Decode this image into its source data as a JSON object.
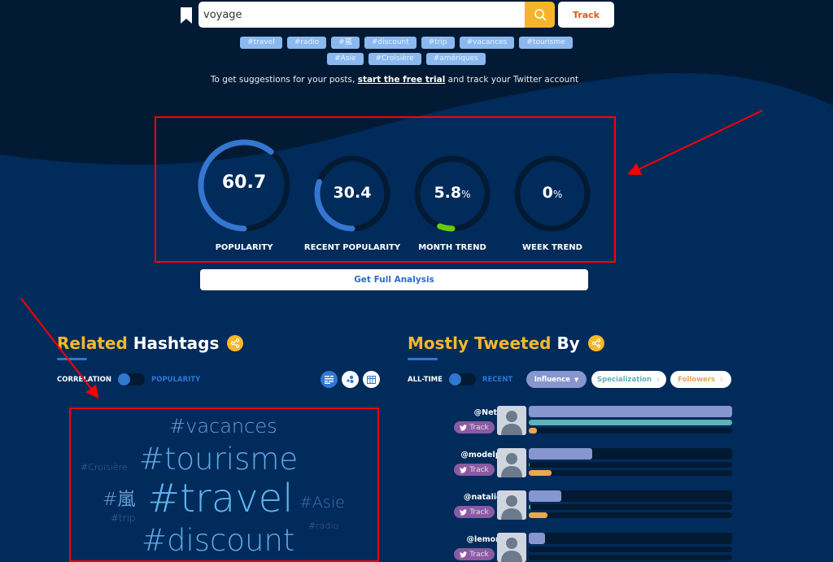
{
  "search": {
    "value": "voyage",
    "track_label": "Track"
  },
  "tags_row1": [
    "#travel",
    "#radio",
    "#嵐",
    "#discount",
    "#trip",
    "#vacances",
    "#tourisme"
  ],
  "tags_row2": [
    "#Asie",
    "#Croisière",
    "#amériques"
  ],
  "suggest": {
    "before": "To get suggestions for your posts, ",
    "link": "start the free trial",
    "after": " and track your Twitter account"
  },
  "metrics": [
    {
      "label": "POPULARITY",
      "value": "60.7",
      "unit": "",
      "fraction": 0.607,
      "color": "#3477d1"
    },
    {
      "label": "RECENT POPULARITY",
      "value": "30.4",
      "unit": "",
      "fraction": 0.304,
      "color": "#3477d1"
    },
    {
      "label": "MONTH TREND",
      "value": "5.8",
      "unit": "%",
      "fraction": 0.058,
      "color": "#66cc11"
    },
    {
      "label": "WEEK TREND",
      "value": "0",
      "unit": "%",
      "fraction": 0,
      "color": "#3477d1"
    }
  ],
  "full_analysis_label": "Get Full Analysis",
  "related": {
    "title_accent": "Related",
    "title_rest": "Hashtags",
    "toggle_left": "CORRELATION",
    "toggle_right": "POPULARITY",
    "cloud": [
      {
        "text": "#vacances",
        "weight": 0.55
      },
      {
        "text": "#tourisme",
        "weight": 0.8
      },
      {
        "text": "#Croisière",
        "weight": 0.2
      },
      {
        "text": "#嵐",
        "weight": 0.45
      },
      {
        "text": "#travel",
        "weight": 1.0
      },
      {
        "text": "#Asie",
        "weight": 0.4
      },
      {
        "text": "#trip",
        "weight": 0.3
      },
      {
        "text": "#radio",
        "weight": 0.25
      },
      {
        "text": "#discount",
        "weight": 0.78
      }
    ]
  },
  "tweeted_by": {
    "title_accent": "Mostly Tweeted",
    "title_rest": "By",
    "toggle_left": "ALL-TIME",
    "toggle_right": "RECENT",
    "sort_influence": "Influence",
    "sort_specialization": "Specialization",
    "sort_followers": "Followers",
    "track_label": "Track",
    "users": [
      {
        "handle": "@NetflixJP",
        "influence": 1.0,
        "specialization": 1.0,
        "followers": 0.04
      },
      {
        "handle": "@modelpress",
        "influence": 0.31,
        "specialization": 0.003,
        "followers": 0.11
      },
      {
        "handle": "@natalie_mu",
        "influence": 0.16,
        "specialization": 0.008,
        "followers": 0.09
      },
      {
        "handle": "@lemondefr",
        "influence": 0.08,
        "specialization": 0.0,
        "followers": 0.0
      }
    ]
  },
  "colors": {
    "accent_yellow": "#f7b72c",
    "accent_blue": "#3477d1",
    "influence_bar": "#8796cf",
    "specialization_bar": "#5fb0b8",
    "followers_bar": "#eaa84a",
    "annotation_red": "#ff0000"
  }
}
